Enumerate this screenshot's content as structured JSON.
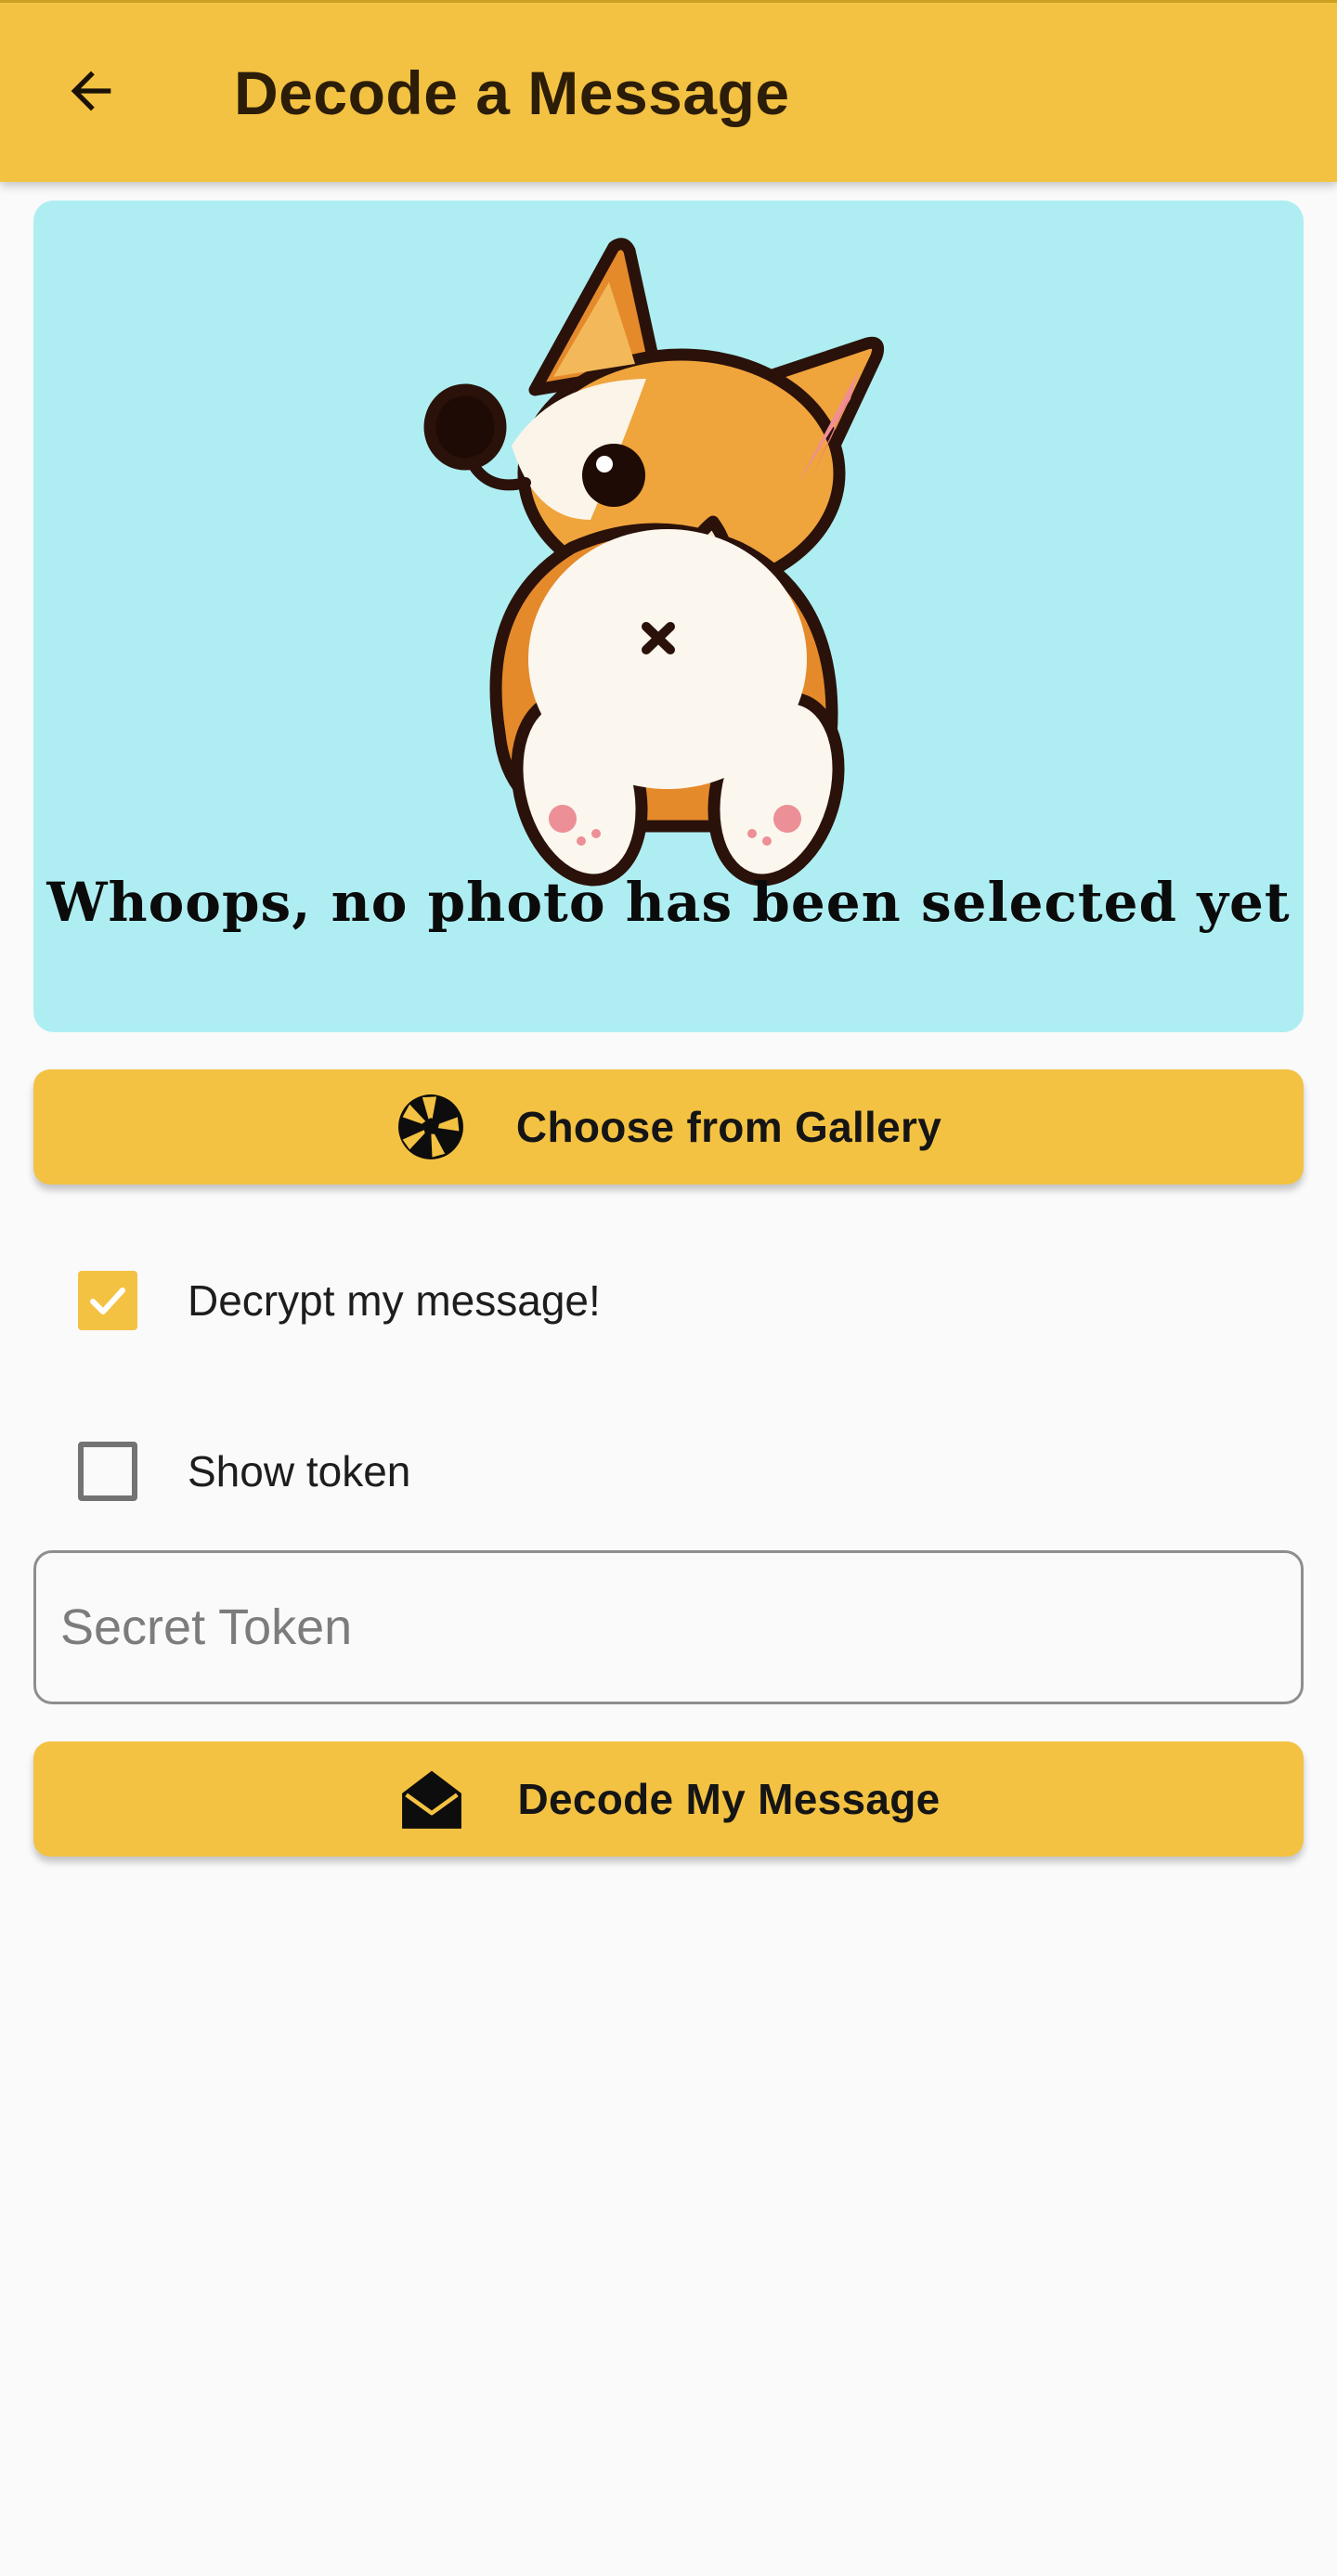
{
  "appbar": {
    "title": "Decode a Message",
    "back_icon": "arrow-left-icon",
    "background": "#f4c242"
  },
  "photo_preview": {
    "message": "Whoops, no photo has been selected yet",
    "illustration": "corgi-illustration",
    "background": "#aeeef2"
  },
  "gallery_button": {
    "label": "Choose from Gallery",
    "icon": "camera-aperture-icon"
  },
  "decrypt_option": {
    "label": "Decrypt my message!",
    "checked": true
  },
  "show_token_option": {
    "label": "Show token",
    "checked": false
  },
  "token_field": {
    "placeholder": "Secret Token",
    "value": ""
  },
  "decode_button": {
    "label": "Decode My Message",
    "icon": "envelope-open-icon"
  }
}
